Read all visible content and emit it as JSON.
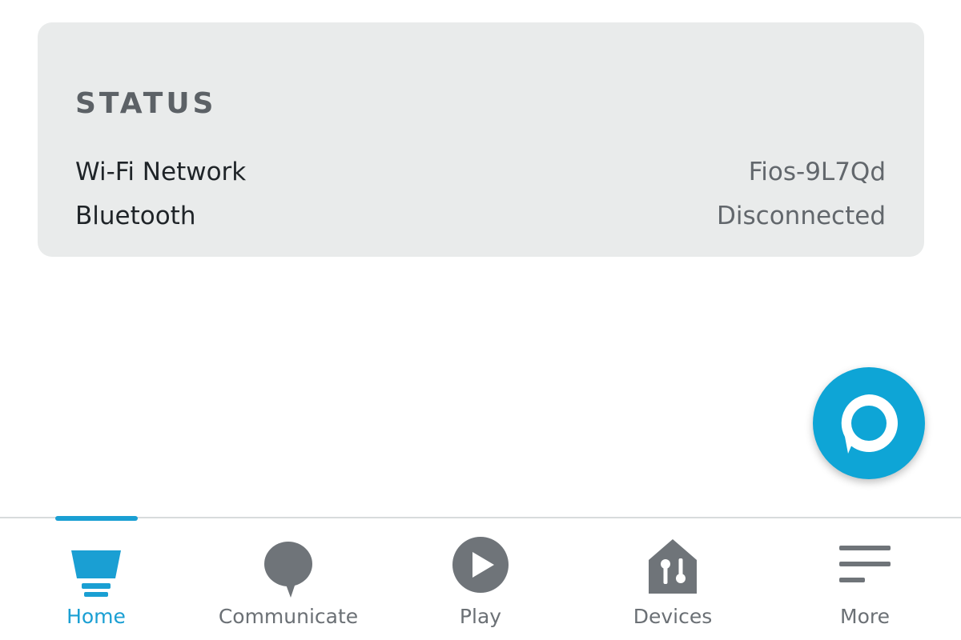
{
  "status": {
    "heading": "STATUS",
    "rows": [
      {
        "label": "Wi-Fi Network",
        "value": "Fios-9L7Qd"
      },
      {
        "label": "Bluetooth",
        "value": "Disconnected"
      }
    ]
  },
  "fab": {
    "icon": "alexa-icon"
  },
  "nav": {
    "items": [
      {
        "label": "Home",
        "icon": "home-echo-icon",
        "active": true
      },
      {
        "label": "Communicate",
        "icon": "chat-bubble-icon",
        "active": false
      },
      {
        "label": "Play",
        "icon": "play-icon",
        "active": false
      },
      {
        "label": "Devices",
        "icon": "devices-house-icon",
        "active": false
      },
      {
        "label": "More",
        "icon": "menu-lines-icon",
        "active": false
      }
    ]
  },
  "colors": {
    "accent": "#1a9fd3",
    "fab": "#0ea5d6",
    "card_bg": "#e9ebeb",
    "icon_gray": "#6f7479"
  }
}
